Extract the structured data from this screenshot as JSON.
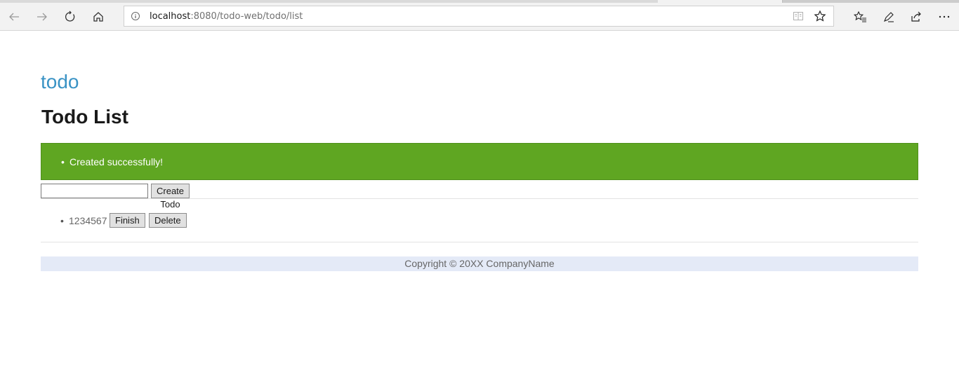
{
  "browser": {
    "url_host": "localhost",
    "url_rest": ":8080/todo-web/todo/list",
    "icons": [
      "back-icon",
      "forward-icon",
      "refresh-icon",
      "home-icon",
      "site-info-icon",
      "reading-view-icon",
      "favorite-star-icon",
      "favorites-list-icon",
      "pen-icon",
      "share-icon",
      "more-icon"
    ]
  },
  "page": {
    "brand": "todo",
    "title": "Todo List",
    "alert_message": "Created successfully!",
    "bullet": "•",
    "create_button": "Create Todo",
    "input_value": "",
    "todos": [
      {
        "text": "1234567",
        "finish_label": "Finish",
        "delete_label": "Delete"
      }
    ],
    "footer": "Copyright © 20XX CompanyName"
  },
  "colors": {
    "brand": "#3a93c5",
    "alert_bg": "#5fa622",
    "footer_bg": "#e4eaf7"
  }
}
